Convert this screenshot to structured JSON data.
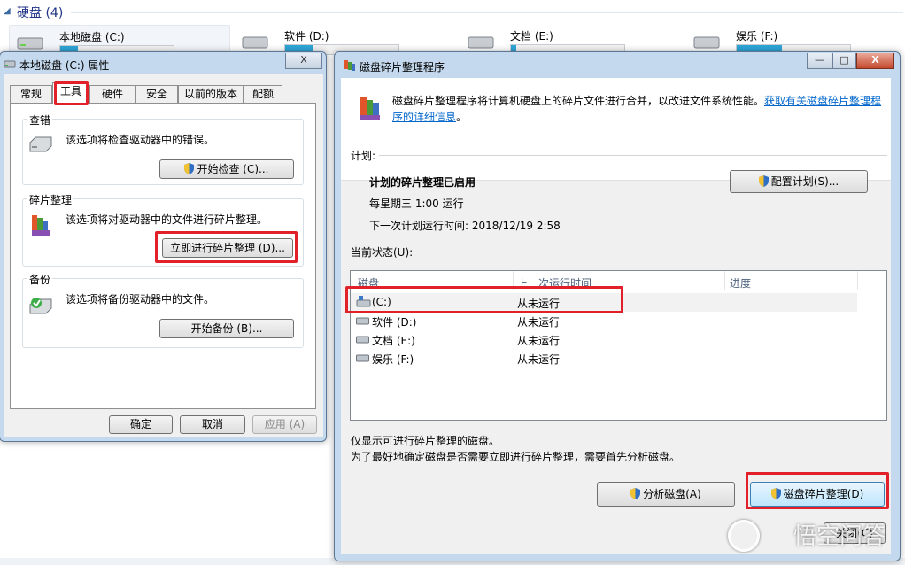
{
  "explorer": {
    "section_title": "硬盘 (4)",
    "drives": [
      {
        "name": "本地磁盘 (C:)",
        "used": 0.16
      },
      {
        "name": "软件 (D:)",
        "used": 0.25
      },
      {
        "name": "文档 (E:)",
        "used": 0.05
      },
      {
        "name": "娱乐 (F:)",
        "used": 0.4
      }
    ]
  },
  "props": {
    "title": "本地磁盘 (C:) 属性",
    "close_glyph": "X",
    "tabs": [
      "常规",
      "工具",
      "硬件",
      "安全",
      "以前的版本",
      "配额"
    ],
    "active_tab": "工具",
    "check": {
      "title": "查错",
      "text": "该选项将检查驱动器中的错误。",
      "button": "开始检查 (C)..."
    },
    "defrag": {
      "title": "碎片整理",
      "text": "该选项将对驱动器中的文件进行碎片整理。",
      "button": "立即进行碎片整理 (D)..."
    },
    "backup": {
      "title": "备份",
      "text": "该选项将备份驱动器中的文件。",
      "button": "开始备份 (B)..."
    },
    "ok": "确定",
    "cancel": "取消",
    "apply": "应用 (A)"
  },
  "defrag": {
    "title": "磁盘碎片整理程序",
    "min_glyph": "—",
    "max_glyph": "□",
    "close_glyph": "X",
    "description": "磁盘碎片整理程序将计算机硬盘上的碎片文件进行合并，以改进文件系统性能。",
    "link": "获取有关磁盘碎片整理程序的详细信息",
    "link_end": "。",
    "schedule_label": "计划:",
    "schedule_enabled": "计划的碎片整理已启用",
    "schedule_freq": "每星期三  1:00 运行",
    "next_run": "下一次计划运行时间: 2018/12/19 2:58",
    "configure_button": "配置计划(S)...",
    "current_status_label": "当前状态(U):",
    "columns": [
      "磁盘",
      "上一次运行时间",
      "进度"
    ],
    "disks": [
      {
        "name": "(C:)",
        "last_run": "从未运行"
      },
      {
        "name": "软件 (D:)",
        "last_run": "从未运行"
      },
      {
        "name": "文档 (E:)",
        "last_run": "从未运行"
      },
      {
        "name": "娱乐 (F:)",
        "last_run": "从未运行"
      }
    ],
    "note1": "仅显示可进行碎片整理的磁盘。",
    "note2": "为了最好地确定磁盘是否需要立即进行碎片整理，需要首先分析磁盘。",
    "analyze_button": "分析磁盘(A)",
    "defrag_button": "磁盘碎片整理(D)",
    "close_button_partial": "关闭(C)"
  },
  "watermark": "悟空问答",
  "colors": {
    "highlight": "#e2202a",
    "link": "#0066cc",
    "usage_bar": "#2ea6d8"
  }
}
